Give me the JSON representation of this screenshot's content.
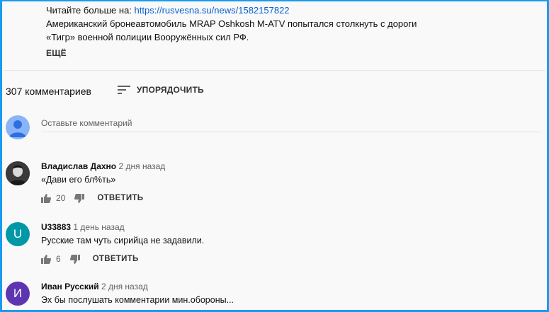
{
  "description": {
    "read_more_prefix": "Читайте больше на:",
    "read_more_link": "https://rusvesna.su/news/1582157822",
    "line1": "Американский бронеавтомобиль MRAP Oshkosh M-ATV попытался столкнуть с дороги",
    "line2": "«Тигр» военной полиции Вооружённых сил РФ.",
    "more_label": "ЕЩЁ"
  },
  "comments_header": {
    "count_label": "307 комментариев",
    "sort_label": "УПОРЯДОЧИТЬ"
  },
  "add_comment": {
    "placeholder": "Оставьте комментарий"
  },
  "comments": [
    {
      "author": "Владислав Дахно",
      "time": "2 дня назад",
      "text": "«Дави его бл%ть»",
      "likes": "20",
      "reply": "ОТВЕТИТЬ",
      "avatar_letter": "",
      "avatar_color": "#2b2b2b"
    },
    {
      "author": "U33883",
      "time": "1 день назад",
      "text": "Русские там чуть сирийца не задавили.",
      "likes": "6",
      "reply": "ОТВЕТИТЬ",
      "avatar_letter": "U",
      "avatar_color": "#0097a7"
    },
    {
      "author": "Иван Русский",
      "time": "2 дня назад",
      "text": "Эх бы послушать комментарии мин.обороны...",
      "avatar_letter": "И",
      "avatar_color": "#5e35b1"
    }
  ],
  "icons": {
    "sort": "sort-icon",
    "like": "thumb-up-icon",
    "dislike": "thumb-down-icon",
    "avatar": "person-icon"
  },
  "colors": {
    "link": "#065fd4",
    "frame": "#1a9bf0"
  }
}
